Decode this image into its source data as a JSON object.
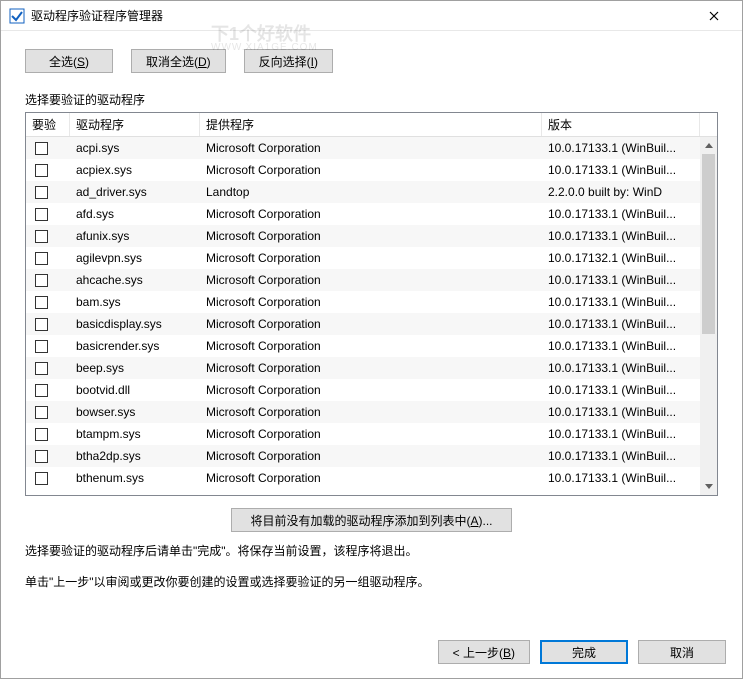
{
  "window": {
    "title": "驱动程序验证程序管理器",
    "watermark_line1": "下1个好软件",
    "watermark_line2": "WWW.XIA1GE.COM"
  },
  "buttons": {
    "select_all": "全选(S)",
    "deselect_all": "取消全选(D)",
    "invert": "反向选择(I)",
    "add_unloaded": "将目前没有加载的驱动程序添加到列表中(A)...",
    "back": "< 上一步(B)",
    "finish": "完成",
    "cancel": "取消"
  },
  "labels": {
    "section": "选择要验证的驱动程序",
    "help1": "选择要验证的驱动程序后请单击\"完成\"。将保存当前设置，该程序将退出。",
    "help2": "单击\"上一步\"以审阅或更改你要创建的设置或选择要验证的另一组驱动程序。"
  },
  "columns": {
    "chk": "要验",
    "driver": "驱动程序",
    "provider": "提供程序",
    "version": "版本"
  },
  "rows": [
    {
      "driver": "acpi.sys",
      "provider": "Microsoft Corporation",
      "version": "10.0.17133.1 (WinBuil..."
    },
    {
      "driver": "acpiex.sys",
      "provider": "Microsoft Corporation",
      "version": "10.0.17133.1 (WinBuil..."
    },
    {
      "driver": "ad_driver.sys",
      "provider": "Landtop",
      "version": "2.2.0.0 built by: WinD"
    },
    {
      "driver": "afd.sys",
      "provider": "Microsoft Corporation",
      "version": "10.0.17133.1 (WinBuil..."
    },
    {
      "driver": "afunix.sys",
      "provider": "Microsoft Corporation",
      "version": "10.0.17133.1 (WinBuil..."
    },
    {
      "driver": "agilevpn.sys",
      "provider": "Microsoft Corporation",
      "version": "10.0.17132.1 (WinBuil..."
    },
    {
      "driver": "ahcache.sys",
      "provider": "Microsoft Corporation",
      "version": "10.0.17133.1 (WinBuil..."
    },
    {
      "driver": "bam.sys",
      "provider": "Microsoft Corporation",
      "version": "10.0.17133.1 (WinBuil..."
    },
    {
      "driver": "basicdisplay.sys",
      "provider": "Microsoft Corporation",
      "version": "10.0.17133.1 (WinBuil..."
    },
    {
      "driver": "basicrender.sys",
      "provider": "Microsoft Corporation",
      "version": "10.0.17133.1 (WinBuil..."
    },
    {
      "driver": "beep.sys",
      "provider": "Microsoft Corporation",
      "version": "10.0.17133.1 (WinBuil..."
    },
    {
      "driver": "bootvid.dll",
      "provider": "Microsoft Corporation",
      "version": "10.0.17133.1 (WinBuil..."
    },
    {
      "driver": "bowser.sys",
      "provider": "Microsoft Corporation",
      "version": "10.0.17133.1 (WinBuil..."
    },
    {
      "driver": "btampm.sys",
      "provider": "Microsoft Corporation",
      "version": "10.0.17133.1 (WinBuil..."
    },
    {
      "driver": "btha2dp.sys",
      "provider": "Microsoft Corporation",
      "version": "10.0.17133.1 (WinBuil..."
    },
    {
      "driver": "bthenum.sys",
      "provider": "Microsoft Corporation",
      "version": "10.0.17133.1 (WinBuil..."
    }
  ]
}
